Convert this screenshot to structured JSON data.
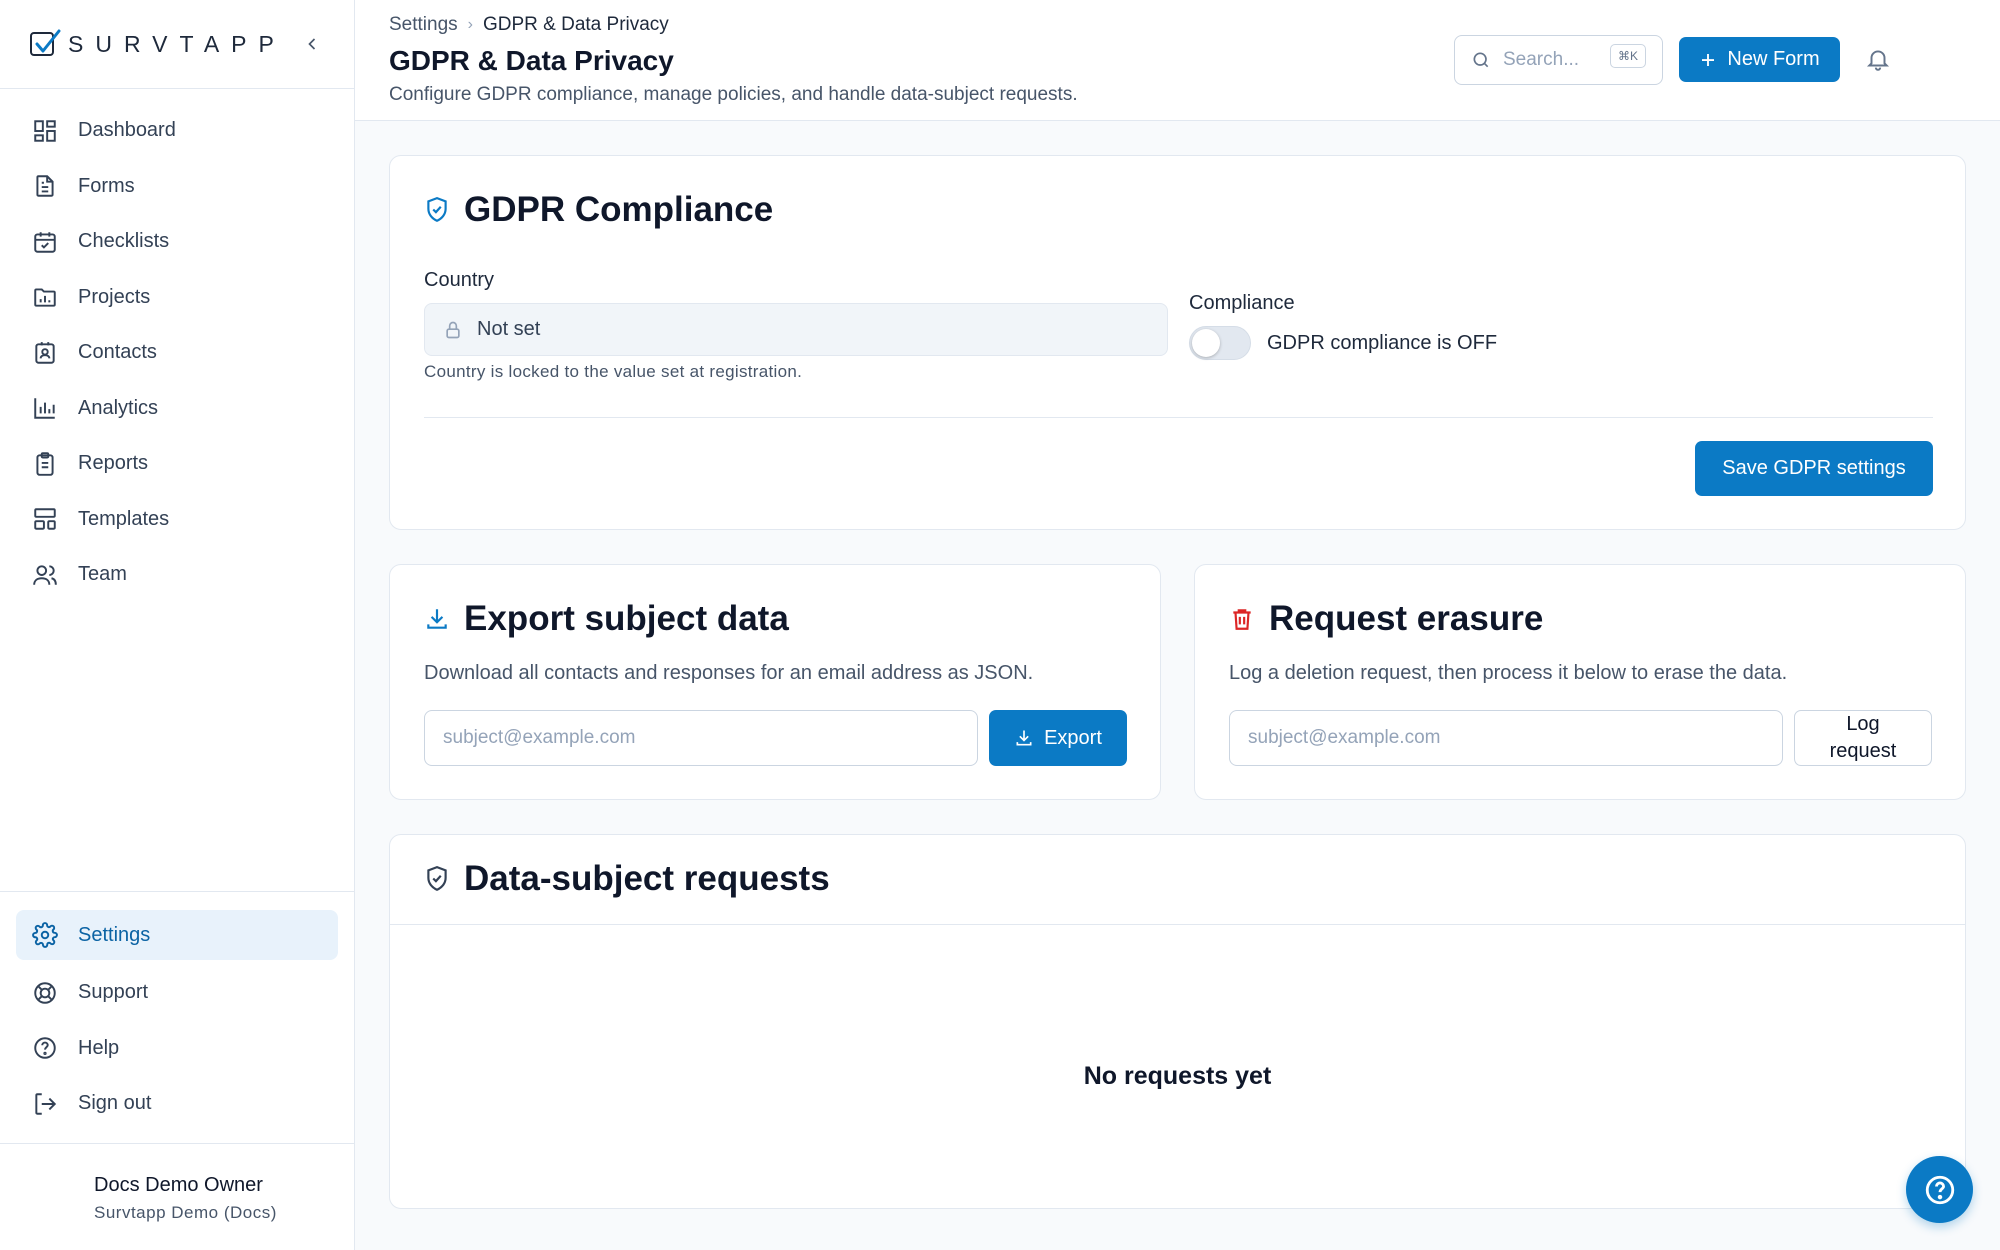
{
  "brand": {
    "name": "SURVTAPP"
  },
  "sidebar": {
    "items": [
      {
        "label": "Dashboard",
        "icon": "dashboard-icon"
      },
      {
        "label": "Forms",
        "icon": "document-icon"
      },
      {
        "label": "Checklists",
        "icon": "calendar-check-icon"
      },
      {
        "label": "Projects",
        "icon": "folder-chart-icon"
      },
      {
        "label": "Contacts",
        "icon": "contact-card-icon"
      },
      {
        "label": "Analytics",
        "icon": "bar-chart-icon"
      },
      {
        "label": "Reports",
        "icon": "clipboard-icon"
      },
      {
        "label": "Templates",
        "icon": "layout-icon"
      },
      {
        "label": "Team",
        "icon": "users-icon"
      }
    ],
    "bottom_items": [
      {
        "label": "Settings",
        "icon": "gear-icon",
        "active": true
      },
      {
        "label": "Support",
        "icon": "lifebuoy-icon"
      },
      {
        "label": "Help",
        "icon": "question-circle-icon"
      },
      {
        "label": "Sign out",
        "icon": "sign-out-icon"
      }
    ],
    "user": {
      "name": "Docs Demo Owner",
      "org": "Survtapp Demo (Docs)"
    }
  },
  "header": {
    "breadcrumb": {
      "parent": "Settings",
      "current": "GDPR & Data Privacy"
    },
    "title": "GDPR & Data Privacy",
    "subtitle": "Configure GDPR compliance, manage policies, and handle data-subject requests.",
    "search": {
      "placeholder": "Search...",
      "shortcut": "⌘K"
    },
    "new_form_label": "New Form"
  },
  "gdpr": {
    "title": "GDPR Compliance",
    "country_label": "Country",
    "country_value": "Not set",
    "country_help": "Country is locked to the value set at registration.",
    "compliance_label": "Compliance",
    "compliance_status": "GDPR compliance is OFF",
    "compliance_on": false,
    "save_label": "Save GDPR settings"
  },
  "export": {
    "title": "Export subject data",
    "description": "Download all contacts and responses for an email address as JSON.",
    "placeholder": "subject@example.com",
    "button_label": "Export"
  },
  "erasure": {
    "title": "Request erasure",
    "description": "Log a deletion request, then process it below to erase the data.",
    "placeholder": "subject@example.com",
    "button_label": "Log request"
  },
  "requests": {
    "title": "Data-subject requests",
    "empty_text": "No requests yet"
  },
  "colors": {
    "accent": "#0b7ac5",
    "active_bg": "#e8f2fb",
    "danger": "#dc2626"
  }
}
